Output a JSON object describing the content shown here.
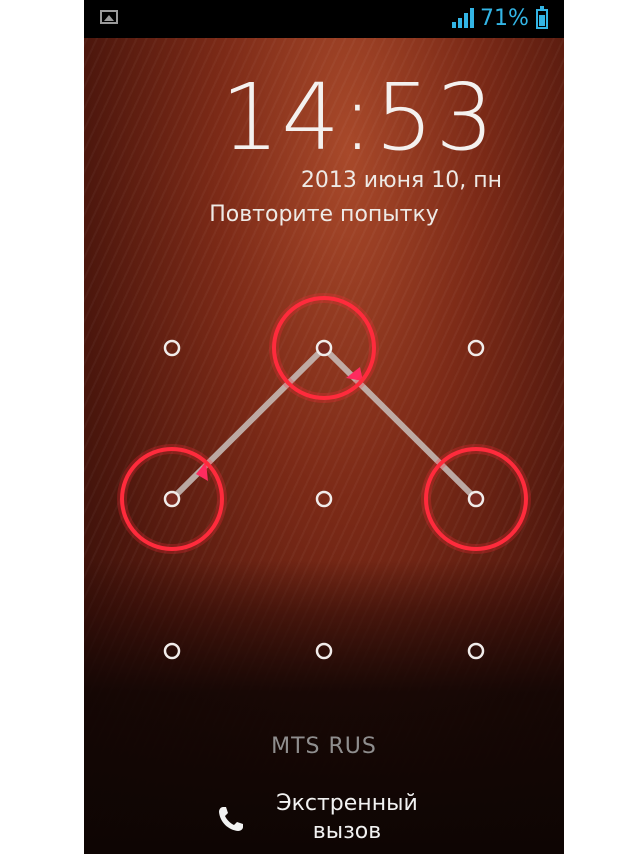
{
  "status_bar": {
    "left_icon": "image-notification-icon",
    "signal_icon": "signal-strength-icon",
    "battery_percent": "71%",
    "battery_icon": "battery-icon",
    "accent_color": "#33b5e5"
  },
  "lockscreen": {
    "time": "14:53",
    "date": "2013 июня 10, пн",
    "hint": "Повторите попытку",
    "error_color": "#ff2b3c"
  },
  "pattern": {
    "grid_size": 3,
    "selected_dots": [
      [
        0,
        1
      ],
      [
        1,
        0
      ],
      [
        1,
        2
      ]
    ]
  },
  "carrier": "MTS RUS",
  "emergency": {
    "line1": "Экстренный",
    "line2": "вызов",
    "icon": "phone-icon"
  }
}
